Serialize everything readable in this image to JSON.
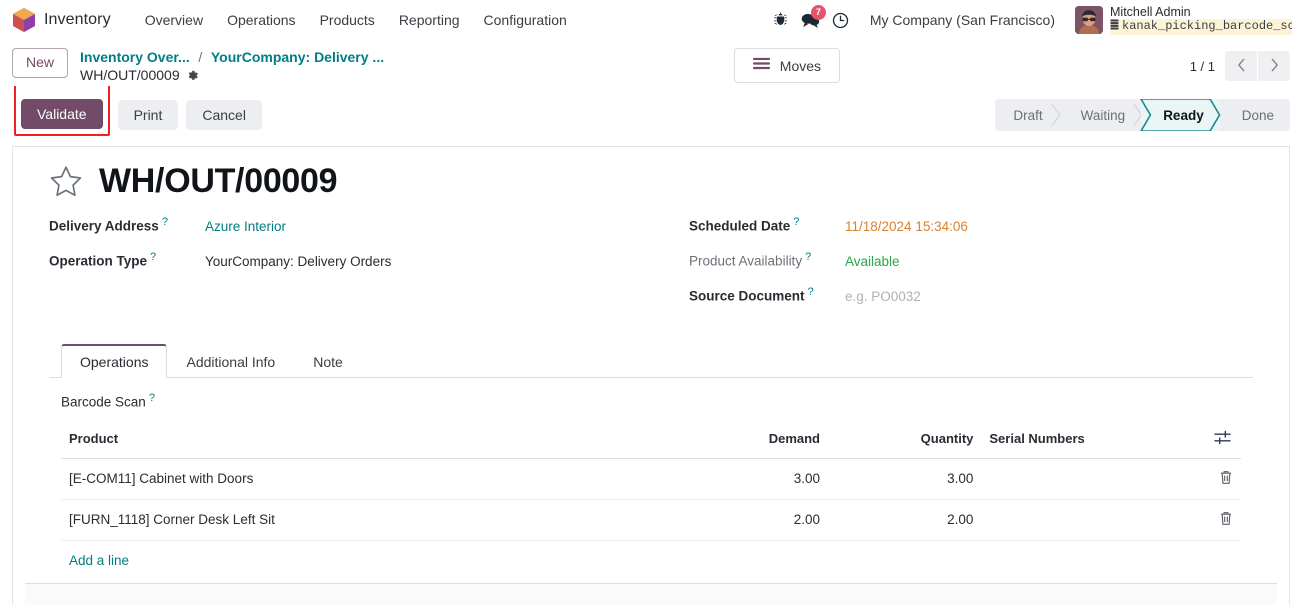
{
  "navbar": {
    "brand": "Inventory",
    "menu": [
      "Overview",
      "Operations",
      "Products",
      "Reporting",
      "Configuration"
    ],
    "bug_icon": "bug-icon",
    "messages_icon": "messages-icon",
    "messages_count": "7",
    "activities_icon": "clock-icon",
    "company": "My Company (San Francisco)",
    "user_name": "Mitchell Admin",
    "database": "kanak_picking_barcode_sc…",
    "database_icon": "database-icon"
  },
  "control_panel": {
    "new_label": "New",
    "breadcrumb": {
      "root": "Inventory Over...",
      "separator": "/",
      "parent": "YourCompany: Delivery ...",
      "current": "WH/OUT/00009",
      "settings_icon": "gear-icon"
    },
    "moves_button": "Moves",
    "moves_icon": "list-icon",
    "pager": {
      "count": "1 / 1",
      "prev_icon": "chevron-left-icon",
      "next_icon": "chevron-right-icon"
    }
  },
  "action_bar": {
    "validate_label": "Validate",
    "print_label": "Print",
    "cancel_label": "Cancel",
    "highlight_color": "#f02020",
    "primary_color": "#714b67",
    "statuses": [
      {
        "label": "Draft",
        "active": false
      },
      {
        "label": "Waiting",
        "active": false
      },
      {
        "label": "Ready",
        "active": true
      },
      {
        "label": "Done",
        "active": false
      }
    ]
  },
  "form": {
    "favorite_icon": "star-icon",
    "title": "WH/OUT/00009",
    "left_fields": [
      {
        "label": "Delivery Address",
        "value": "Azure Interior",
        "style": "link",
        "help": "?"
      },
      {
        "label": "Operation Type",
        "value": "YourCompany: Delivery Orders",
        "style": "plain",
        "help": "?"
      }
    ],
    "right_fields": [
      {
        "label": "Scheduled Date",
        "value": "11/18/2024 15:34:06",
        "style": "date",
        "help": "?"
      },
      {
        "label": "Product Availability",
        "value": "Available",
        "style": "ok",
        "help": "?"
      },
      {
        "label": "Source Document",
        "value": "e.g. PO0032",
        "style": "placeholder",
        "help": "?"
      }
    ],
    "tabs": [
      {
        "label": "Operations",
        "active": true
      },
      {
        "label": "Additional Info",
        "active": false
      },
      {
        "label": "Note",
        "active": false
      }
    ],
    "barcode_scan_label": "Barcode Scan",
    "table": {
      "columns": [
        "Product",
        "Demand",
        "Quantity",
        "Serial Numbers"
      ],
      "optional_icon": "column-settings-icon",
      "rows": [
        {
          "product": "[E-COM11] Cabinet with Doors",
          "demand": "3.00",
          "quantity": "3.00",
          "serial_numbers": "",
          "delete_icon": "trash-icon"
        },
        {
          "product": "[FURN_1118] Corner Desk Left Sit",
          "demand": "2.00",
          "quantity": "2.00",
          "serial_numbers": "",
          "delete_icon": "trash-icon"
        }
      ],
      "add_line_label": "Add a line"
    }
  },
  "colors": {
    "accent": "#714b67",
    "link": "#017e84",
    "date": "#d9822b",
    "success": "#28a745",
    "danger": "#e4556d"
  }
}
